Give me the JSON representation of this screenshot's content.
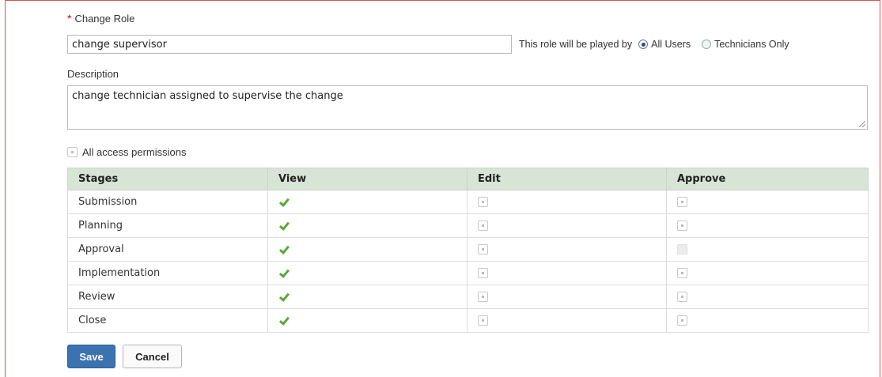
{
  "form": {
    "role_label": "Change Role",
    "required_marker": "*",
    "role_value": "change supervisor",
    "played_by_label": "This role will be played by",
    "played_by_options": [
      {
        "label": "All Users",
        "selected": true
      },
      {
        "label": "Technicians Only",
        "selected": false
      }
    ],
    "description_label": "Description",
    "description_value": "change technician assigned to supervise the change",
    "all_access_label": "All access permissions"
  },
  "table": {
    "headers": [
      "Stages",
      "View",
      "Edit",
      "Approve"
    ],
    "rows": [
      {
        "stage": "Submission",
        "view": true,
        "edit": false,
        "approve": false,
        "approve_disabled": false
      },
      {
        "stage": "Planning",
        "view": true,
        "edit": false,
        "approve": false,
        "approve_disabled": false
      },
      {
        "stage": "Approval",
        "view": true,
        "edit": false,
        "approve": false,
        "approve_disabled": true
      },
      {
        "stage": "Implementation",
        "view": true,
        "edit": false,
        "approve": false,
        "approve_disabled": false
      },
      {
        "stage": "Review",
        "view": true,
        "edit": false,
        "approve": false,
        "approve_disabled": false
      },
      {
        "stage": "Close",
        "view": true,
        "edit": false,
        "approve": false,
        "approve_disabled": false
      }
    ]
  },
  "actions": {
    "save_label": "Save",
    "cancel_label": "Cancel"
  },
  "colors": {
    "frame_border": "#d9534f",
    "table_header_bg": "#d8e4d6",
    "check_color": "#5aa83a",
    "save_bg": "#3b72b0"
  }
}
